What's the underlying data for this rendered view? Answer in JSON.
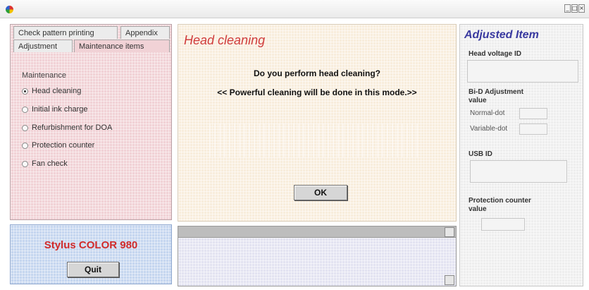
{
  "window": {
    "title": "",
    "minimize_glyph": "_",
    "maximize_glyph": "□",
    "close_glyph": "×"
  },
  "tabs": {
    "row1": [
      "Check pattern printing",
      "Appendix"
    ],
    "row2": [
      "Adjustment",
      "Maintenance items"
    ]
  },
  "maintenance": {
    "group_label": "Maintenance",
    "options": [
      {
        "label": "Head cleaning",
        "selected": true
      },
      {
        "label": "Initial ink charge",
        "selected": false
      },
      {
        "label": "Refurbishment for DOA",
        "selected": false
      },
      {
        "label": "Protection counter",
        "selected": false
      },
      {
        "label": "Fan check",
        "selected": false
      }
    ]
  },
  "main": {
    "title": "Head cleaning",
    "question": "Do you perform head cleaning?",
    "note": "<< Powerful cleaning will be done in this mode.>>",
    "ok_label": "OK"
  },
  "model": {
    "name": "Stylus COLOR 980",
    "quit_label": "Quit"
  },
  "adjusted": {
    "title": "Adjusted Item",
    "head_voltage_label": "Head voltage ID",
    "bid_label": "Bi-D Adjustment value",
    "normal_dot_label": "Normal-dot",
    "variable_dot_label": "Variable-dot",
    "usb_label": "USB ID",
    "protection_label": "Protection counter value"
  },
  "colors": {
    "title_red": "#d03c3c",
    "model_red": "#d02b2b",
    "adjusted_blue": "#3a3aa0"
  }
}
